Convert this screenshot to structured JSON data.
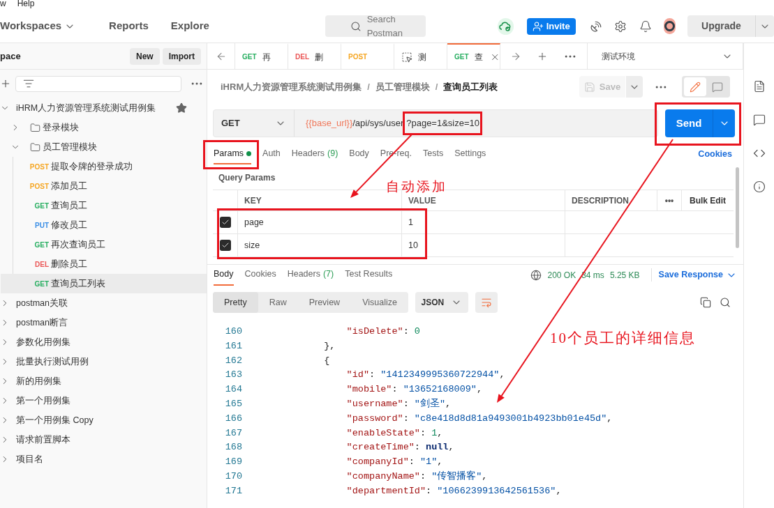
{
  "menu": [
    "w",
    "Help"
  ],
  "header": {
    "nav": [
      {
        "label": "Workspaces",
        "dropdown": true
      },
      {
        "label": "Reports",
        "dropdown": false
      },
      {
        "label": "Explore",
        "dropdown": false
      }
    ],
    "search": {
      "placeholder": "Search Postman"
    },
    "invite": "Invite",
    "upgrade": "Upgrade"
  },
  "sidebar": {
    "title": "pace",
    "buttons": [
      "New",
      "Import"
    ],
    "collections": [
      {
        "name": "iHRM人力资源管理系统测试用例集",
        "expanded": true,
        "starred": true,
        "children": [
          {
            "kind": "folder",
            "name": "登录模块",
            "expanded": false
          },
          {
            "kind": "folder",
            "name": "员工管理模块",
            "expanded": true,
            "children": [
              {
                "kind": "request",
                "method": "POST",
                "color": "#f5a623",
                "name": "提取令牌的登录成功",
                "selected": false
              },
              {
                "kind": "request",
                "method": "POST",
                "color": "#f5a623",
                "name": "添加员工",
                "selected": false
              },
              {
                "kind": "request",
                "method": "GET",
                "color": "#27ae60",
                "name": "查询员工",
                "selected": false
              },
              {
                "kind": "request",
                "method": "PUT",
                "color": "#3a8ee6",
                "name": "修改员工",
                "selected": false
              },
              {
                "kind": "request",
                "method": "GET",
                "color": "#27ae60",
                "name": "再次查询员工",
                "selected": false
              },
              {
                "kind": "request",
                "method": "DEL",
                "color": "#eb5757",
                "name": "删除员工",
                "selected": false
              },
              {
                "kind": "request",
                "method": "GET",
                "color": "#27ae60",
                "name": "查询员工列表",
                "selected": true
              }
            ]
          }
        ]
      },
      {
        "name": "postman关联",
        "expanded": false,
        "starred": false
      },
      {
        "name": "postman断言",
        "expanded": false,
        "starred": false
      },
      {
        "name": "参数化用例集",
        "expanded": false,
        "starred": false
      },
      {
        "name": "批量执行测试用例",
        "expanded": false,
        "starred": false
      },
      {
        "name": "新的用例集",
        "expanded": false,
        "starred": false
      },
      {
        "name": "第一个用例集",
        "expanded": false,
        "starred": false
      },
      {
        "name": "第一个用例集 Copy",
        "expanded": false,
        "starred": false
      },
      {
        "name": "请求前置脚本",
        "expanded": false,
        "starred": false
      },
      {
        "name": "项目名",
        "expanded": false,
        "starred": false
      }
    ]
  },
  "tabs": [
    {
      "kind": "request",
      "method": "GET",
      "color": "#27ae60",
      "name": "再",
      "selected": false
    },
    {
      "kind": "request",
      "method": "DEL",
      "color": "#eb5757",
      "name": "删",
      "selected": false
    },
    {
      "kind": "request",
      "method": "POST",
      "color": "#f5a623",
      "selected": false
    },
    {
      "kind": "environment",
      "name": "测",
      "selected": false
    },
    {
      "kind": "request",
      "method": "GET",
      "color": "#27ae60",
      "name": "查",
      "selected": true
    }
  ],
  "environment": "测试环境",
  "breadcrumb": [
    {
      "kind": "crumb",
      "text": "iHRM人力资源管理系统测试用例集",
      "current": false
    },
    {
      "kind": "separator",
      "text": "/"
    },
    {
      "kind": "crumb",
      "text": "员工管理模块",
      "current": false
    },
    {
      "kind": "separator",
      "text": "/"
    },
    {
      "kind": "crumb",
      "text": "查询员工列表",
      "current": true
    }
  ],
  "save": "Save",
  "request": {
    "method": "GET",
    "url": {
      "variable": "{{base_url}}",
      "path": "/api/sys/user",
      "query": "?page=1&size=10"
    },
    "send": "Send"
  },
  "request_tabs": [
    {
      "label": "Params",
      "dot": true,
      "selected": true
    },
    {
      "label": "Auth",
      "dot": false,
      "selected": false
    },
    {
      "label": "Headers",
      "count": "(9)",
      "dot": false,
      "selected": false
    },
    {
      "label": "Body",
      "dot": false,
      "selected": false
    },
    {
      "label": "Pre-req.",
      "dot": false,
      "selected": false
    },
    {
      "label": "Tests",
      "dot": false,
      "selected": false
    },
    {
      "label": "Settings",
      "dot": false,
      "selected": false
    }
  ],
  "cookies_link": "Cookies",
  "query_params": {
    "title": "Query Params",
    "columns": [
      "KEY",
      "VALUE",
      "DESCRIPTION",
      "•••",
      "Bulk Edit"
    ],
    "rows": [
      {
        "checked": true,
        "key": "page",
        "value": "1"
      },
      {
        "checked": true,
        "key": "size",
        "value": "10"
      }
    ]
  },
  "response": {
    "tabs": [
      {
        "label": "Body",
        "selected": true
      },
      {
        "label": "Cookies",
        "selected": false
      },
      {
        "label": "Headers",
        "count": "(7)",
        "selected": false
      },
      {
        "label": "Test Results",
        "selected": false
      }
    ],
    "status": "200 OK",
    "time": "34 ms",
    "size": "5.25 KB",
    "save_response": "Save Response",
    "views": [
      {
        "label": "Pretty",
        "selected": true
      },
      {
        "label": "Raw",
        "selected": false
      },
      {
        "label": "Preview",
        "selected": false
      },
      {
        "label": "Visualize",
        "selected": false
      }
    ],
    "format": "JSON",
    "lines": [
      {
        "number": "160",
        "tokens": [
          {
            "kind": "key",
            "text": "                \"isDelete\""
          },
          {
            "kind": "punct",
            "text": ": "
          },
          {
            "kind": "number",
            "text": "0"
          }
        ]
      },
      {
        "number": "161",
        "tokens": [
          {
            "kind": "punct",
            "text": "            },"
          }
        ]
      },
      {
        "number": "162",
        "tokens": [
          {
            "kind": "punct",
            "text": "            {"
          }
        ]
      },
      {
        "number": "163",
        "tokens": [
          {
            "kind": "key",
            "text": "                \"id\""
          },
          {
            "kind": "punct",
            "text": ": "
          },
          {
            "kind": "string",
            "text": "\"1412349995360722944\""
          },
          {
            "kind": "punct",
            "text": ","
          }
        ]
      },
      {
        "number": "164",
        "tokens": [
          {
            "kind": "key",
            "text": "                \"mobile\""
          },
          {
            "kind": "punct",
            "text": ": "
          },
          {
            "kind": "string",
            "text": "\"13652168009\""
          },
          {
            "kind": "punct",
            "text": ","
          }
        ]
      },
      {
        "number": "165",
        "tokens": [
          {
            "kind": "key",
            "text": "                \"username\""
          },
          {
            "kind": "punct",
            "text": ": "
          },
          {
            "kind": "string",
            "text": "\"剑圣\""
          },
          {
            "kind": "punct",
            "text": ","
          }
        ]
      },
      {
        "number": "166",
        "tokens": [
          {
            "kind": "key",
            "text": "                \"password\""
          },
          {
            "kind": "punct",
            "text": ": "
          },
          {
            "kind": "string",
            "text": "\"c8e418d8d81a9493001b4923bb01e45d\""
          },
          {
            "kind": "punct",
            "text": ","
          }
        ]
      },
      {
        "number": "167",
        "tokens": [
          {
            "kind": "key",
            "text": "                \"enableState\""
          },
          {
            "kind": "punct",
            "text": ": "
          },
          {
            "kind": "number",
            "text": "1"
          },
          {
            "kind": "punct",
            "text": ","
          }
        ]
      },
      {
        "number": "168",
        "tokens": [
          {
            "kind": "key",
            "text": "                \"createTime\""
          },
          {
            "kind": "punct",
            "text": ": "
          },
          {
            "kind": "null",
            "text": "null"
          },
          {
            "kind": "punct",
            "text": ","
          }
        ]
      },
      {
        "number": "169",
        "tokens": [
          {
            "kind": "key",
            "text": "                \"companyId\""
          },
          {
            "kind": "punct",
            "text": ": "
          },
          {
            "kind": "string",
            "text": "\"1\""
          },
          {
            "kind": "punct",
            "text": ","
          }
        ]
      },
      {
        "number": "170",
        "tokens": [
          {
            "kind": "key",
            "text": "                \"companyName\""
          },
          {
            "kind": "punct",
            "text": ": "
          },
          {
            "kind": "string",
            "text": "\"传智播客\""
          },
          {
            "kind": "punct",
            "text": ","
          }
        ]
      },
      {
        "number": "171",
        "tokens": [
          {
            "kind": "key",
            "text": "                \"departmentId\""
          },
          {
            "kind": "punct",
            "text": ": "
          },
          {
            "kind": "string",
            "text": "\"1066239913642561536\""
          },
          {
            "kind": "punct",
            "text": ","
          }
        ]
      }
    ]
  },
  "annotations": [
    "自动添加",
    "10个员工的详细信息"
  ]
}
